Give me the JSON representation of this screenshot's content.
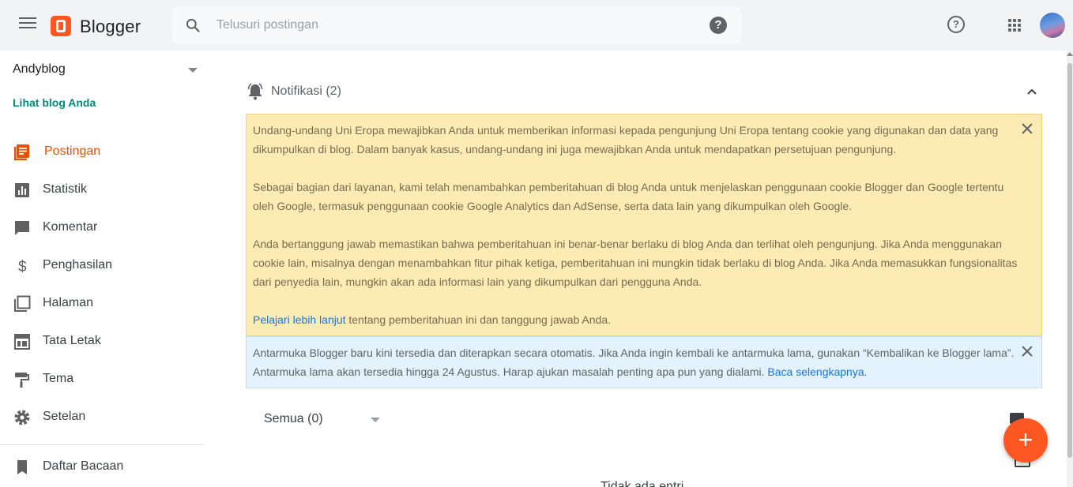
{
  "header": {
    "brand": "Blogger",
    "search_placeholder": "Telusuri postingan",
    "search_help": "?",
    "help": "?"
  },
  "sidebar": {
    "blog_name": "Andyblog",
    "view_blog": "Lihat blog Anda",
    "items": [
      {
        "label": "Postingan",
        "icon": "posts-icon",
        "active": true
      },
      {
        "label": "Statistik",
        "icon": "stats-icon"
      },
      {
        "label": "Komentar",
        "icon": "comment-icon"
      },
      {
        "label": "Penghasilan",
        "icon": "dollar-icon"
      },
      {
        "label": "Halaman",
        "icon": "pages-icon"
      },
      {
        "label": "Tata Letak",
        "icon": "layout-icon"
      },
      {
        "label": "Tema",
        "icon": "paint-roller-icon"
      },
      {
        "label": "Setelan",
        "icon": "gear-icon"
      },
      {
        "label": "Daftar Bacaan",
        "icon": "bookmark-icon"
      }
    ]
  },
  "notifications": {
    "title": "Notifikasi (2)",
    "yellow": {
      "p1": "Undang-undang Uni Eropa mewajibkan Anda untuk memberikan informasi kepada pengunjung Uni Eropa tentang cookie yang digunakan dan data yang dikumpulkan di blog. Dalam banyak kasus, undang-undang ini juga mewajibkan Anda untuk mendapatkan persetujuan pengunjung.",
      "p2": "Sebagai bagian dari layanan, kami telah menambahkan pemberitahuan di blog Anda untuk menjelaskan penggunaan cookie Blogger dan Google tertentu oleh Google, termasuk penggunaan cookie Google Analytics dan AdSense, serta data lain yang dikumpulkan oleh Google.",
      "p3": "Anda bertanggung jawab memastikan bahwa pemberitahuan ini benar-benar berlaku di blog Anda dan terlihat oleh pengunjung. Jika Anda menggunakan cookie lain, misalnya dengan menambahkan fitur pihak ketiga, pemberitahuan ini mungkin tidak berlaku di blog Anda. Jika Anda memasukkan fungsionalitas dari penyedia lain, mungkin akan ada informasi lain yang dikumpulkan dari pengguna Anda.",
      "link": "Pelajari lebih lanjut",
      "p4_rest": " tentang pemberitahuan ini dan tanggung jawab Anda."
    },
    "blue": {
      "text": "Antarmuka Blogger baru kini tersedia dan diterapkan secara otomatis. Jika Anda ingin kembali ke antarmuka lama, gunakan “Kembalikan ke Blogger lama”. Antarmuka lama akan tersedia hingga 24 Agustus. Harap ajukan masalah penting apa pun yang dialami. ",
      "link": "Baca selengkapnya."
    }
  },
  "posts": {
    "filter": "Semua (0)",
    "empty": "Tidak ada entri",
    "fab": "+"
  },
  "colors": {
    "accent": "#ff5722",
    "active_nav": "#e65100",
    "link": "#1a73e8",
    "view_blog": "#00897b",
    "yellow_bg": "#fcecb4",
    "blue_bg": "#e3f2fd"
  }
}
